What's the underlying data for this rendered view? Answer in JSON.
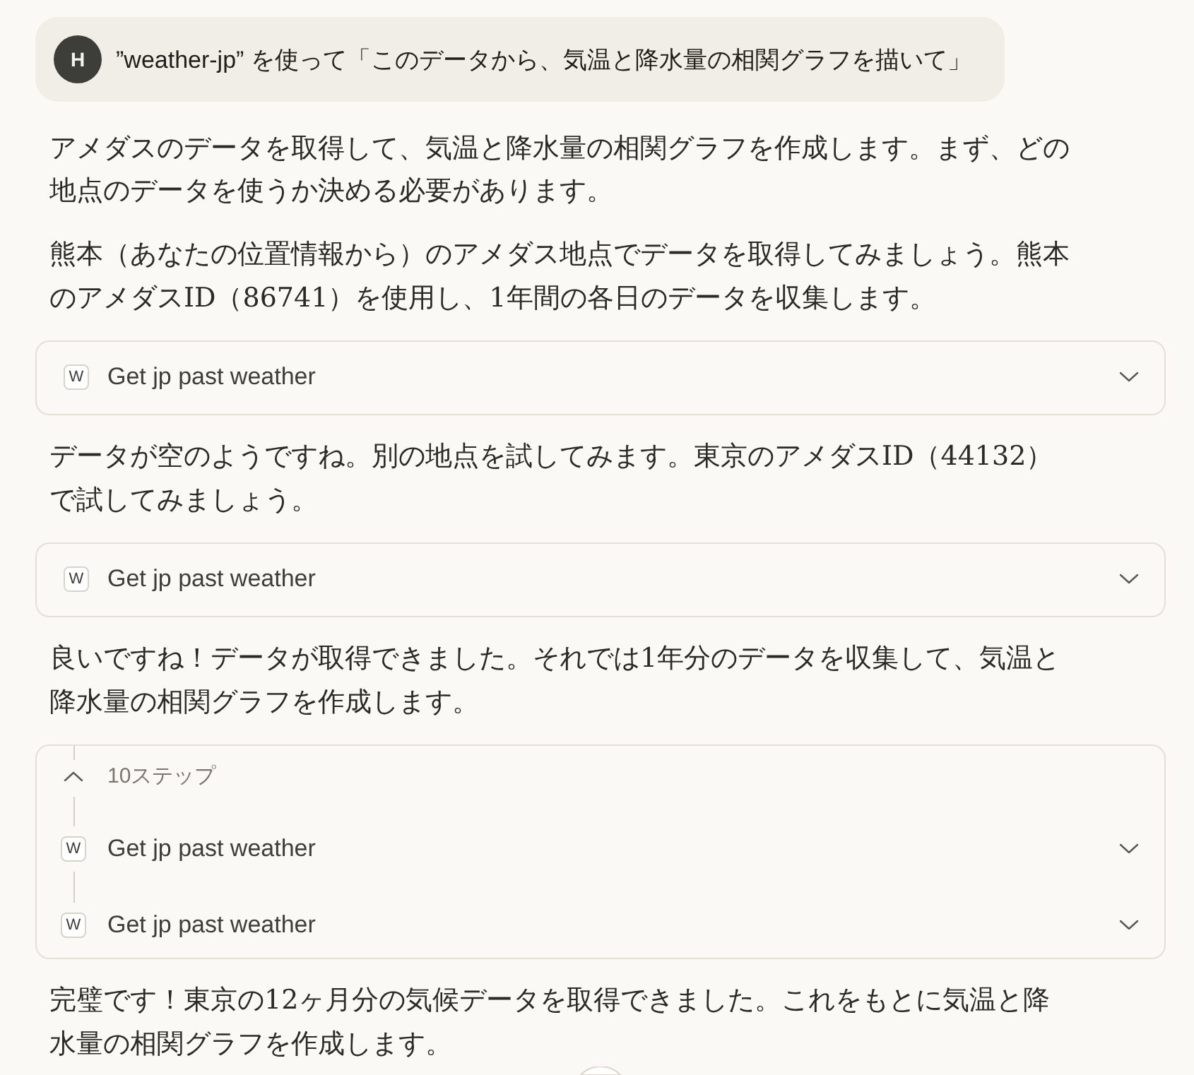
{
  "user_message": {
    "avatar_initial": "H",
    "text": "”weather-jp” を使って「このデータから、気温と降水量の相関グラフを描いて」"
  },
  "messages": [
    {
      "kind": "text",
      "text": "アメダスのデータを取得して、気温と降水量の相関グラフを作成します。まず、どの地点のデータを使うか決める必要があります。"
    },
    {
      "kind": "text",
      "text": "熊本（あなたの位置情報から）のアメダス地点でデータを取得してみましょう。熊本のアメダスID（86741）を使用し、1年間の各日のデータを収集します。"
    },
    {
      "kind": "tool_call",
      "icon_letter": "W",
      "title": "Get jp past weather",
      "expanded": false
    },
    {
      "kind": "text",
      "text": "データが空のようですね。別の地点を試してみます。東京のアメダスID（44132）で試してみましょう。"
    },
    {
      "kind": "tool_call",
      "icon_letter": "W",
      "title": "Get jp past weather",
      "expanded": false
    },
    {
      "kind": "text",
      "text": "良いですね！データが取得できました。それでは1年分のデータを収集して、気温と降水量の相関グラフを作成します。"
    },
    {
      "kind": "step_group",
      "label": "10ステップ",
      "expanded": true,
      "steps": [
        {
          "icon_letter": "W",
          "title": "Get jp past weather",
          "expanded": false
        },
        {
          "icon_letter": "W",
          "title": "Get jp past weather",
          "expanded": false
        }
      ]
    },
    {
      "kind": "text",
      "text": "完璧です！東京の12ヶ月分の気候データを取得できました。これをもとに気温と降水量の相関グラフを作成します。"
    }
  ]
}
